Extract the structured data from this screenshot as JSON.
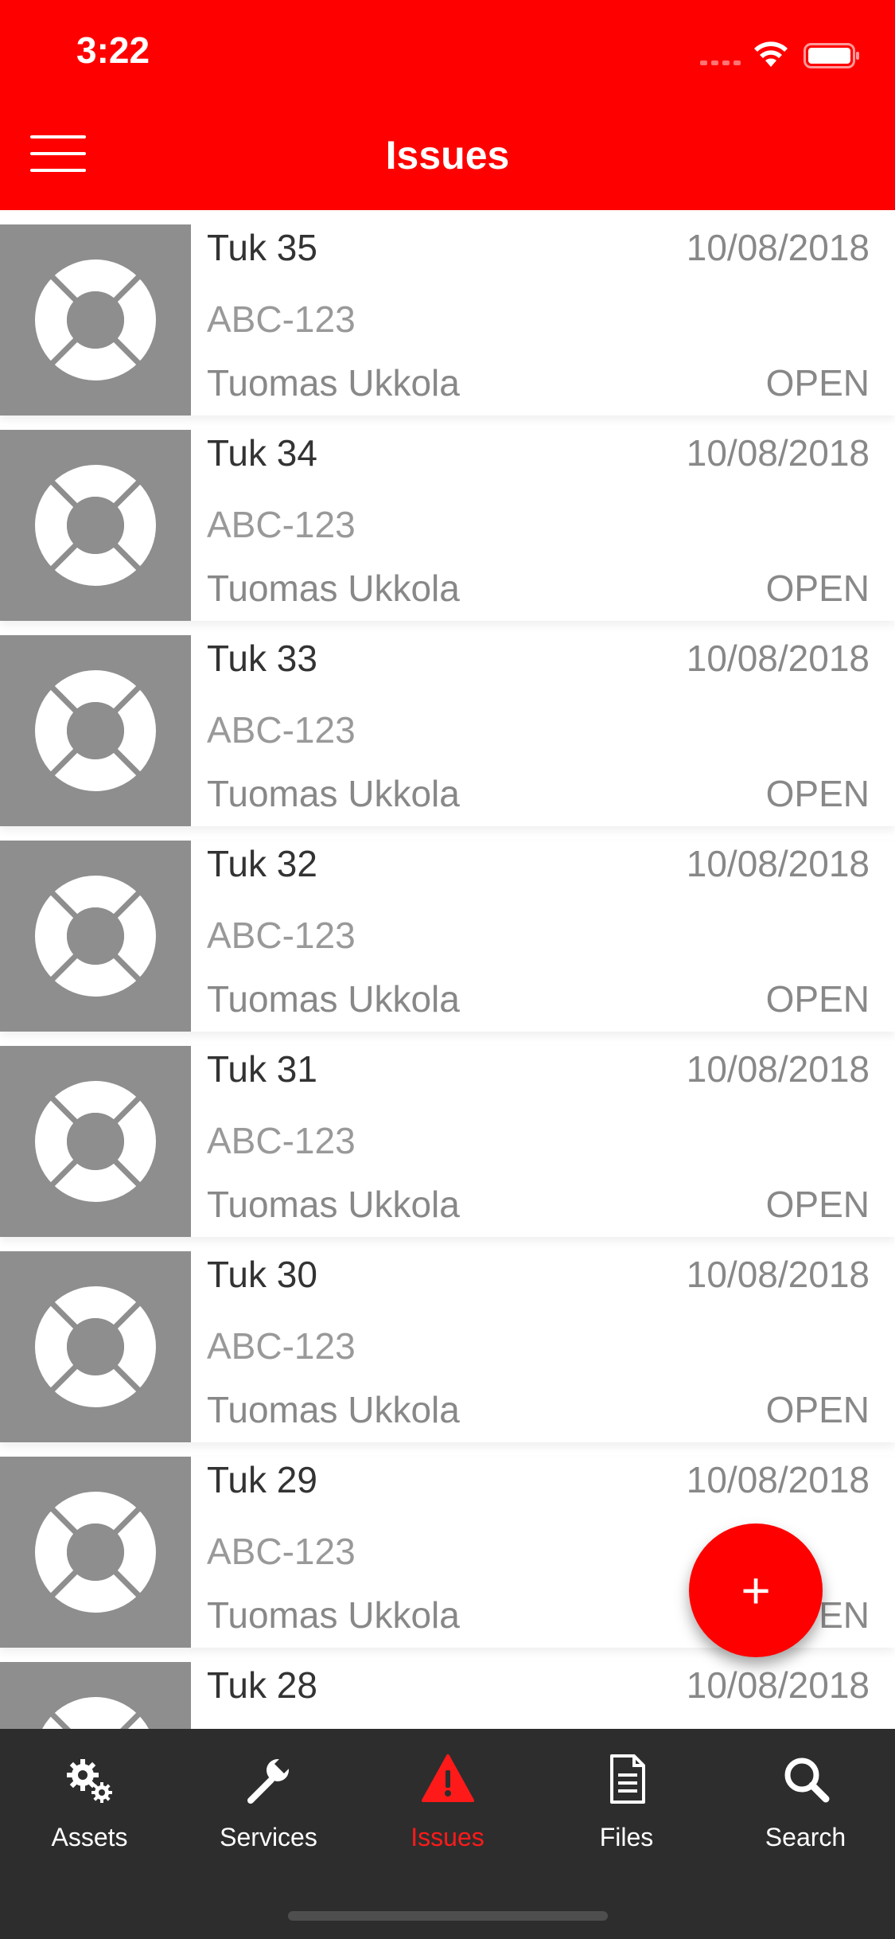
{
  "status_bar": {
    "time": "3:22"
  },
  "header": {
    "title": "Issues"
  },
  "issues": [
    {
      "title": "Tuk 35",
      "date": "10/08/2018",
      "asset": "ABC-123",
      "user": "Tuomas Ukkola",
      "status": "OPEN"
    },
    {
      "title": "Tuk 34",
      "date": "10/08/2018",
      "asset": "ABC-123",
      "user": "Tuomas Ukkola",
      "status": "OPEN"
    },
    {
      "title": "Tuk 33",
      "date": "10/08/2018",
      "asset": "ABC-123",
      "user": "Tuomas Ukkola",
      "status": "OPEN"
    },
    {
      "title": "Tuk 32",
      "date": "10/08/2018",
      "asset": "ABC-123",
      "user": "Tuomas Ukkola",
      "status": "OPEN"
    },
    {
      "title": "Tuk 31",
      "date": "10/08/2018",
      "asset": "ABC-123",
      "user": "Tuomas Ukkola",
      "status": "OPEN"
    },
    {
      "title": "Tuk 30",
      "date": "10/08/2018",
      "asset": "ABC-123",
      "user": "Tuomas Ukkola",
      "status": "OPEN"
    },
    {
      "title": "Tuk 29",
      "date": "10/08/2018",
      "asset": "ABC-123",
      "user": "Tuomas Ukkola",
      "status": "OPEN"
    },
    {
      "title": "Tuk 28",
      "date": "10/08/2018",
      "asset": "",
      "user": "",
      "status": ""
    }
  ],
  "fab": {
    "label": "+"
  },
  "tabs": [
    {
      "label": "Assets",
      "icon": "gears-icon"
    },
    {
      "label": "Services",
      "icon": "wrench-icon"
    },
    {
      "label": "Issues",
      "icon": "warning-icon",
      "active": true
    },
    {
      "label": "Files",
      "icon": "file-icon"
    },
    {
      "label": "Search",
      "icon": "search-icon"
    }
  ],
  "colors": {
    "brand": "#ff0000",
    "tabbar": "#2d2d2d",
    "thumb": "#8e8e8e"
  }
}
